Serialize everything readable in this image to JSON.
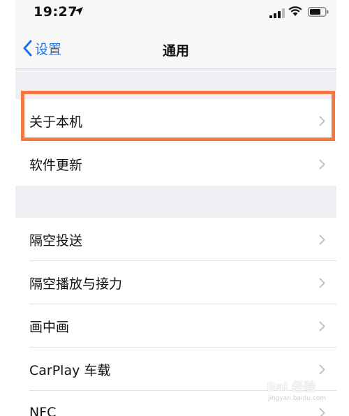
{
  "status_bar": {
    "time": "19:27",
    "location_icon": "location-arrow-icon",
    "signal_icon": "cellular-signal-icon",
    "wifi_icon": "wifi-icon",
    "battery_icon": "battery-icon"
  },
  "nav": {
    "back_label": "设置",
    "title": "通用"
  },
  "group1": {
    "items": [
      {
        "label": "关于本机"
      },
      {
        "label": "软件更新"
      }
    ]
  },
  "group2": {
    "items": [
      {
        "label": "隔空投送"
      },
      {
        "label": "隔空播放与接力"
      },
      {
        "label": "画中画"
      },
      {
        "label": "CarPlay 车载"
      },
      {
        "label": "NFC"
      }
    ]
  },
  "colors": {
    "accent": "#1a73e8",
    "highlight": "#f07a3f",
    "background": "#efeff4"
  },
  "watermark": {
    "logo": "Bai 经验",
    "sub": "jingyan.baidu.com"
  }
}
